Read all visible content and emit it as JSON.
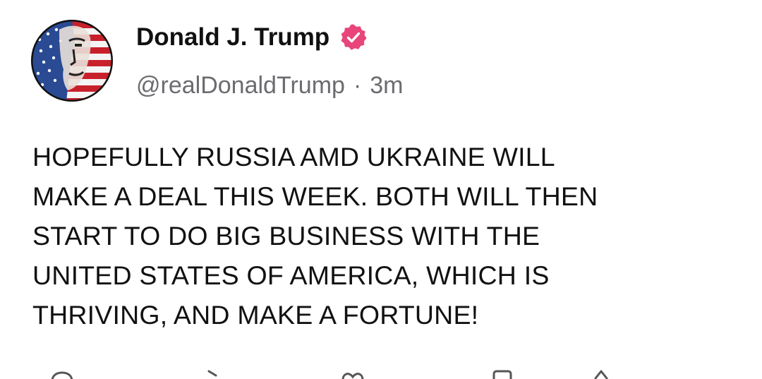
{
  "post": {
    "author": {
      "display_name": "Donald J. Trump",
      "handle": "@realDonaldTrump",
      "verified": true,
      "verified_color": "#e8457a",
      "avatar_icon": "american-flag-portrait-avatar"
    },
    "separator": "·",
    "timestamp": "3m",
    "text": "HOPEFULLY RUSSIA AMD UKRAINE WILL\nMAKE A DEAL THIS WEEK. BOTH WILL THEN\nSTART TO DO BIG BUSINESS WITH THE\nUNITED STATES OF AMERICA, WHICH IS\nTHRIVING, AND MAKE A FORTUNE!",
    "actions": [
      {
        "icon": "reply-icon"
      },
      {
        "icon": "retruth-icon"
      },
      {
        "icon": "like-icon"
      },
      {
        "icon": "bookmark-icon"
      },
      {
        "icon": "share-icon"
      }
    ]
  },
  "colors": {
    "text": "#111111",
    "secondary_text": "#6b6b70",
    "background": "#ffffff"
  }
}
